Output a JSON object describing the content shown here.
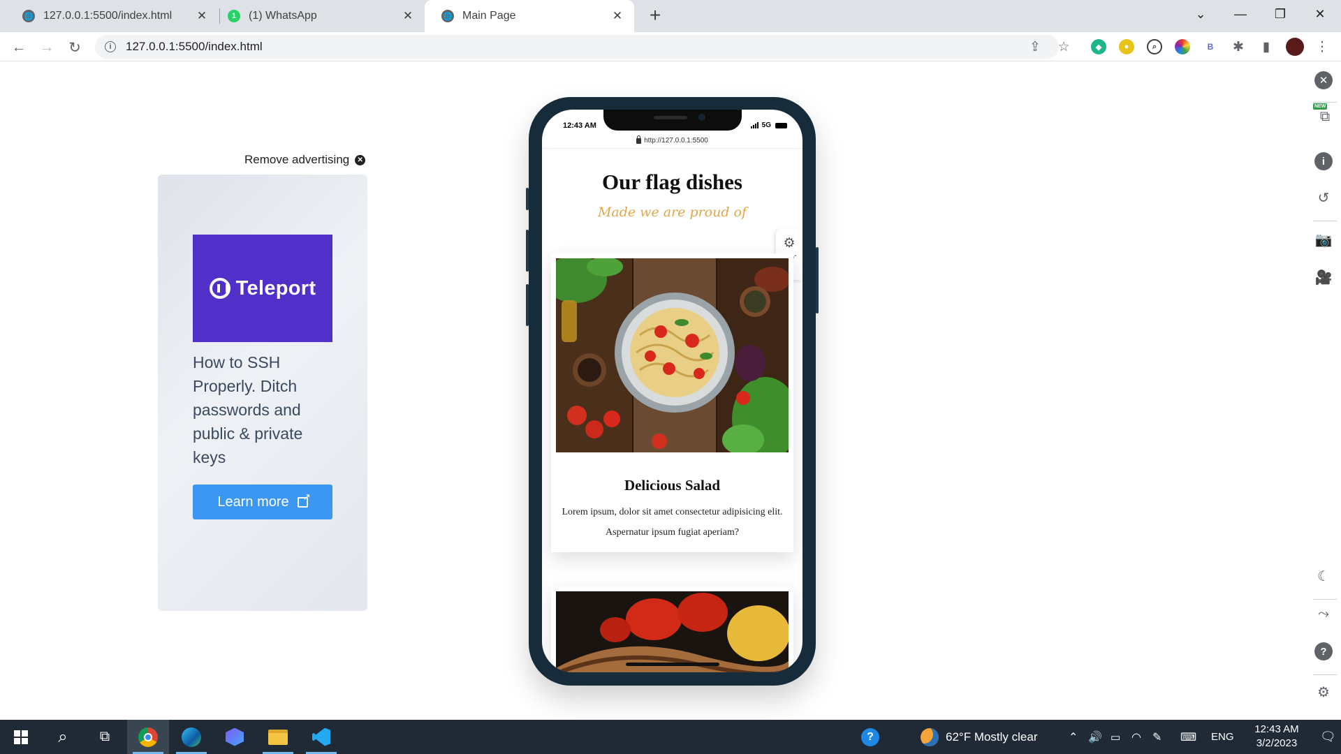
{
  "browser": {
    "tabs": [
      {
        "title": "127.0.0.1:5500/index.html"
      },
      {
        "title": "(1) WhatsApp",
        "badge": "1"
      },
      {
        "title": "Main Page"
      }
    ],
    "url": "127.0.0.1:5500/index.html",
    "extensions": [
      "shield-extension",
      "circle-extension",
      "search-extension",
      "color-extension",
      "b-extension"
    ],
    "ext_b_label": "B"
  },
  "ad": {
    "remove_label": "Remove advertising",
    "brand": "Teleport",
    "text": "How to SSH Properly. Ditch passwords and public & private keys",
    "button": "Learn more",
    "brand_color": "#512fc9",
    "button_color": "#3b97f2"
  },
  "phone": {
    "time": "12:43 AM",
    "network": "5G",
    "address": "http://127.0.0.1:5500",
    "hero_title": "Our flag dishes",
    "hero_subtitle": "Made we are proud of",
    "cards": [
      {
        "title": "Delicious Salad",
        "description": "Lorem ipsum, dolor sit amet consectetur adipisicing elit. Aspernatur ipsum fugiat aperiam?"
      }
    ],
    "accent_color": "#e0a74a"
  },
  "sidepanel": {
    "new_badge": "NEW"
  },
  "taskbar": {
    "weather": "62°F  Mostly clear",
    "language": "ENG",
    "time": "12:43 AM",
    "date": "3/2/2023"
  }
}
